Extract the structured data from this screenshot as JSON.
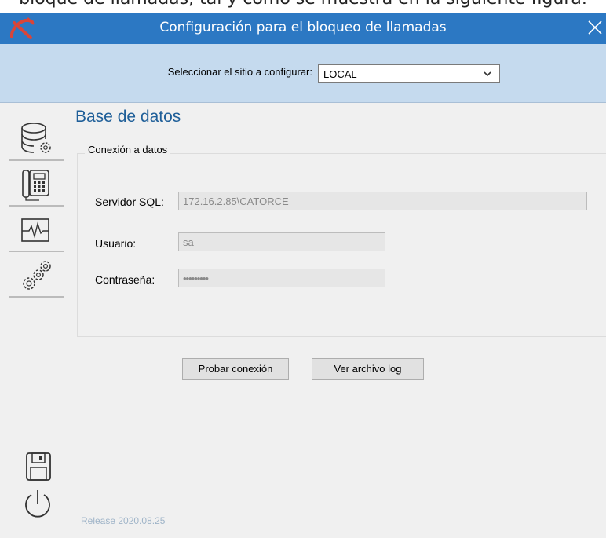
{
  "document_text": "bloque de llamadas, tal y como se muestra en la siguiente figura.",
  "window": {
    "title": "Configuración para el bloqueo de llamadas"
  },
  "site": {
    "label": "Seleccionar el sitio a configurar:",
    "selected": "LOCAL"
  },
  "sidebar": {
    "items": [
      {
        "icon": "database-gear-icon"
      },
      {
        "icon": "phone-icon"
      },
      {
        "icon": "monitor-pulse-icon"
      },
      {
        "icon": "gears-icon"
      }
    ]
  },
  "content": {
    "title": "Base de datos",
    "group_legend": "Conexión a datos",
    "fields": {
      "server": {
        "label": "Servidor SQL:",
        "value": "172.16.2.85\\CATORCE"
      },
      "user": {
        "label": "Usuario:",
        "value": "sa"
      },
      "password": {
        "label": "Contraseña:",
        "value": "•••••••••"
      }
    },
    "buttons": {
      "test": "Probar conexión",
      "log": "Ver archivo log"
    }
  },
  "footer": {
    "release": "Release 2020.08.25"
  },
  "colors": {
    "titlebar": "#2c78c3",
    "band": "#c5daee",
    "heading": "#1f5f99",
    "logo": "#d9453a"
  }
}
